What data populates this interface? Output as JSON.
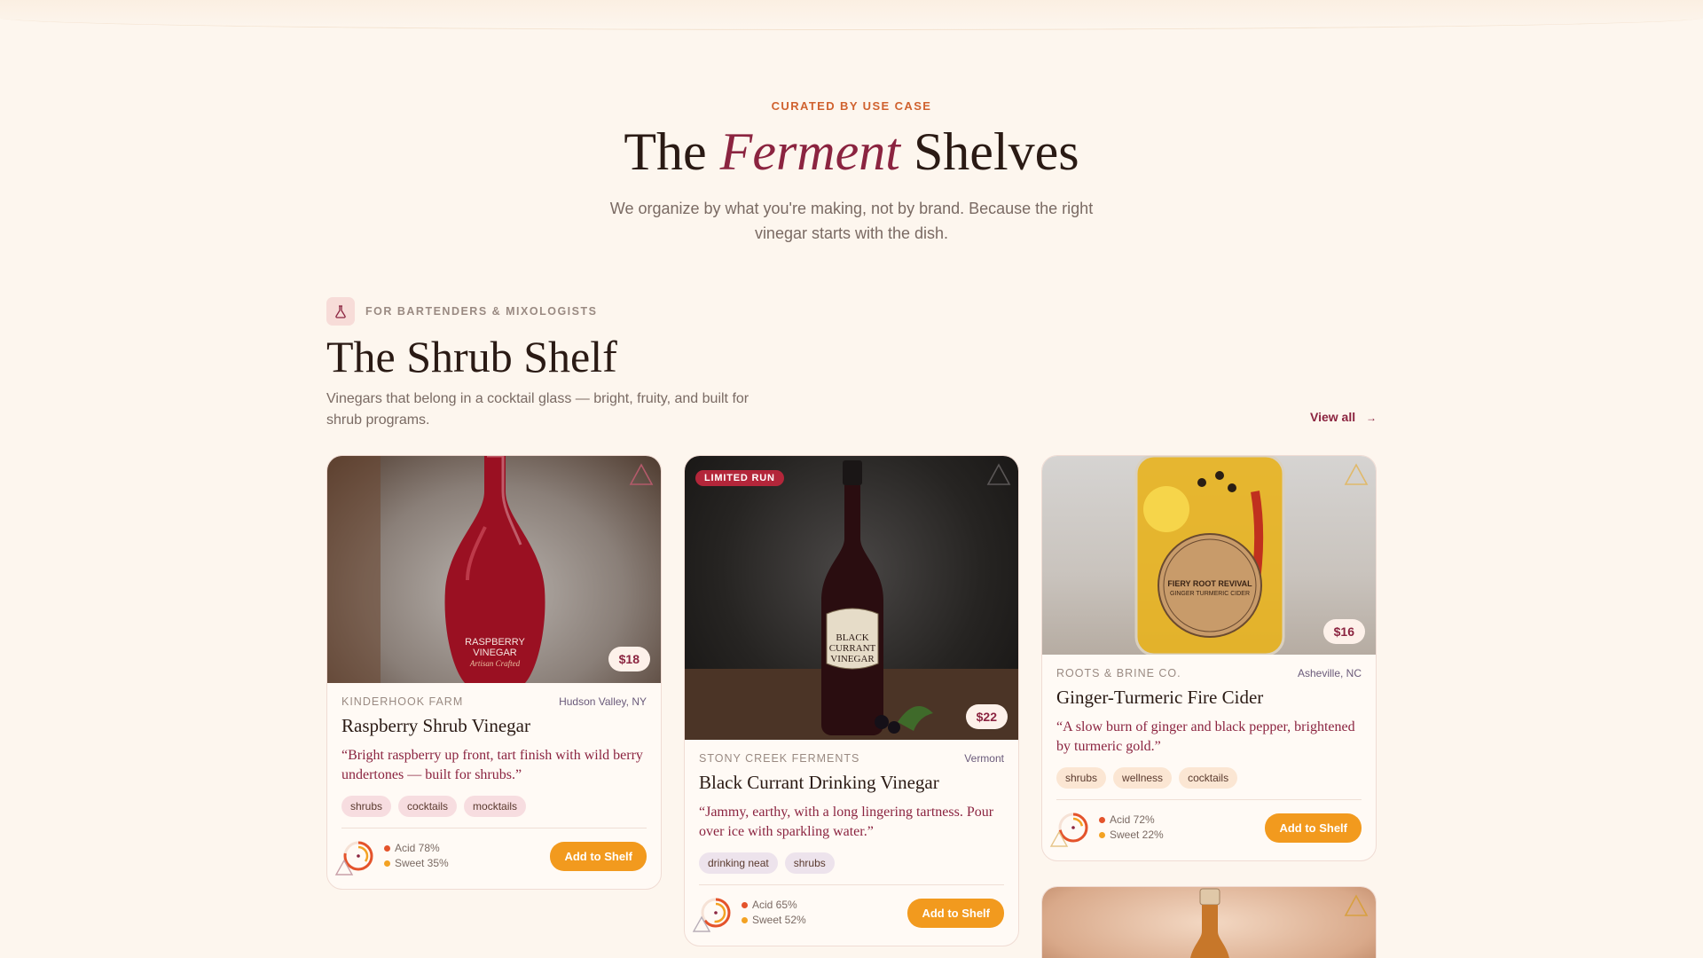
{
  "hero": {
    "eyebrow": "CURATED BY USE CASE",
    "title_pre": "The",
    "title_em": "Ferment",
    "title_post": "Shelves",
    "subtitle": "We organize by what you're making, not by brand. Because the right vinegar starts with the dish."
  },
  "shelf": {
    "icon": "flask-icon",
    "tag": "FOR BARTENDERS & MIXOLOGISTS",
    "title": "The Shrub Shelf",
    "description": "Vinegars that belong in a cocktail glass — bright, fruity, and built for shrub programs.",
    "view_all": "View all",
    "view_all_arrow": "→"
  },
  "colors": {
    "accent": "#8b2440",
    "orange": "#f29a1e",
    "acid": "#e4532b",
    "sweet": "#f3a223",
    "badge": "#b3263a"
  },
  "products": [
    {
      "producer": "KINDERHOOK FARM",
      "region": "Hudson Valley, NY",
      "name": "Raspberry Shrub Vinegar",
      "quote": "“Bright raspberry up front, tart finish with wild berry undertones — built for shrubs.”",
      "price": "$18",
      "chips": [
        "shrubs",
        "cocktails",
        "mocktails"
      ],
      "acid_label": "Acid 78%",
      "sweet_label": "Sweet 35%",
      "acid": 0.78,
      "sweet": 0.35,
      "button": "Add to Shelf",
      "bottle_label_1": "RASPBERRY",
      "bottle_label_2": "VINEGAR",
      "bottle_label_3": "Artisan Crafted"
    },
    {
      "badge": "LIMITED RUN",
      "producer": "STONY CREEK FERMENTS",
      "region": "Vermont",
      "name": "Black Currant Drinking Vinegar",
      "quote": "“Jammy, earthy, with a long lingering tartness. Pour over ice with sparkling water.”",
      "price": "$22",
      "chips": [
        "drinking neat",
        "shrubs"
      ],
      "acid_label": "Acid 65%",
      "sweet_label": "Sweet 52%",
      "acid": 0.65,
      "sweet": 0.52,
      "button": "Add to Shelf",
      "bottle_label_1": "BLACK",
      "bottle_label_2": "CURRANT",
      "bottle_label_3": "VINEGAR"
    },
    {
      "producer": "ROOTS & BRINE CO.",
      "region": "Asheville, NC",
      "name": "Ginger-Turmeric Fire Cider",
      "quote": "“A slow burn of ginger and black pepper, brightened by turmeric gold.”",
      "price": "$16",
      "chips": [
        "shrubs",
        "wellness",
        "cocktails"
      ],
      "acid_label": "Acid 72%",
      "sweet_label": "Sweet 22%",
      "acid": 0.72,
      "sweet": 0.22,
      "button": "Add to Shelf",
      "bottle_label_1": "FIERY ROOT REVIVAL",
      "bottle_label_2": "GINGER TURMERIC CIDER"
    }
  ]
}
